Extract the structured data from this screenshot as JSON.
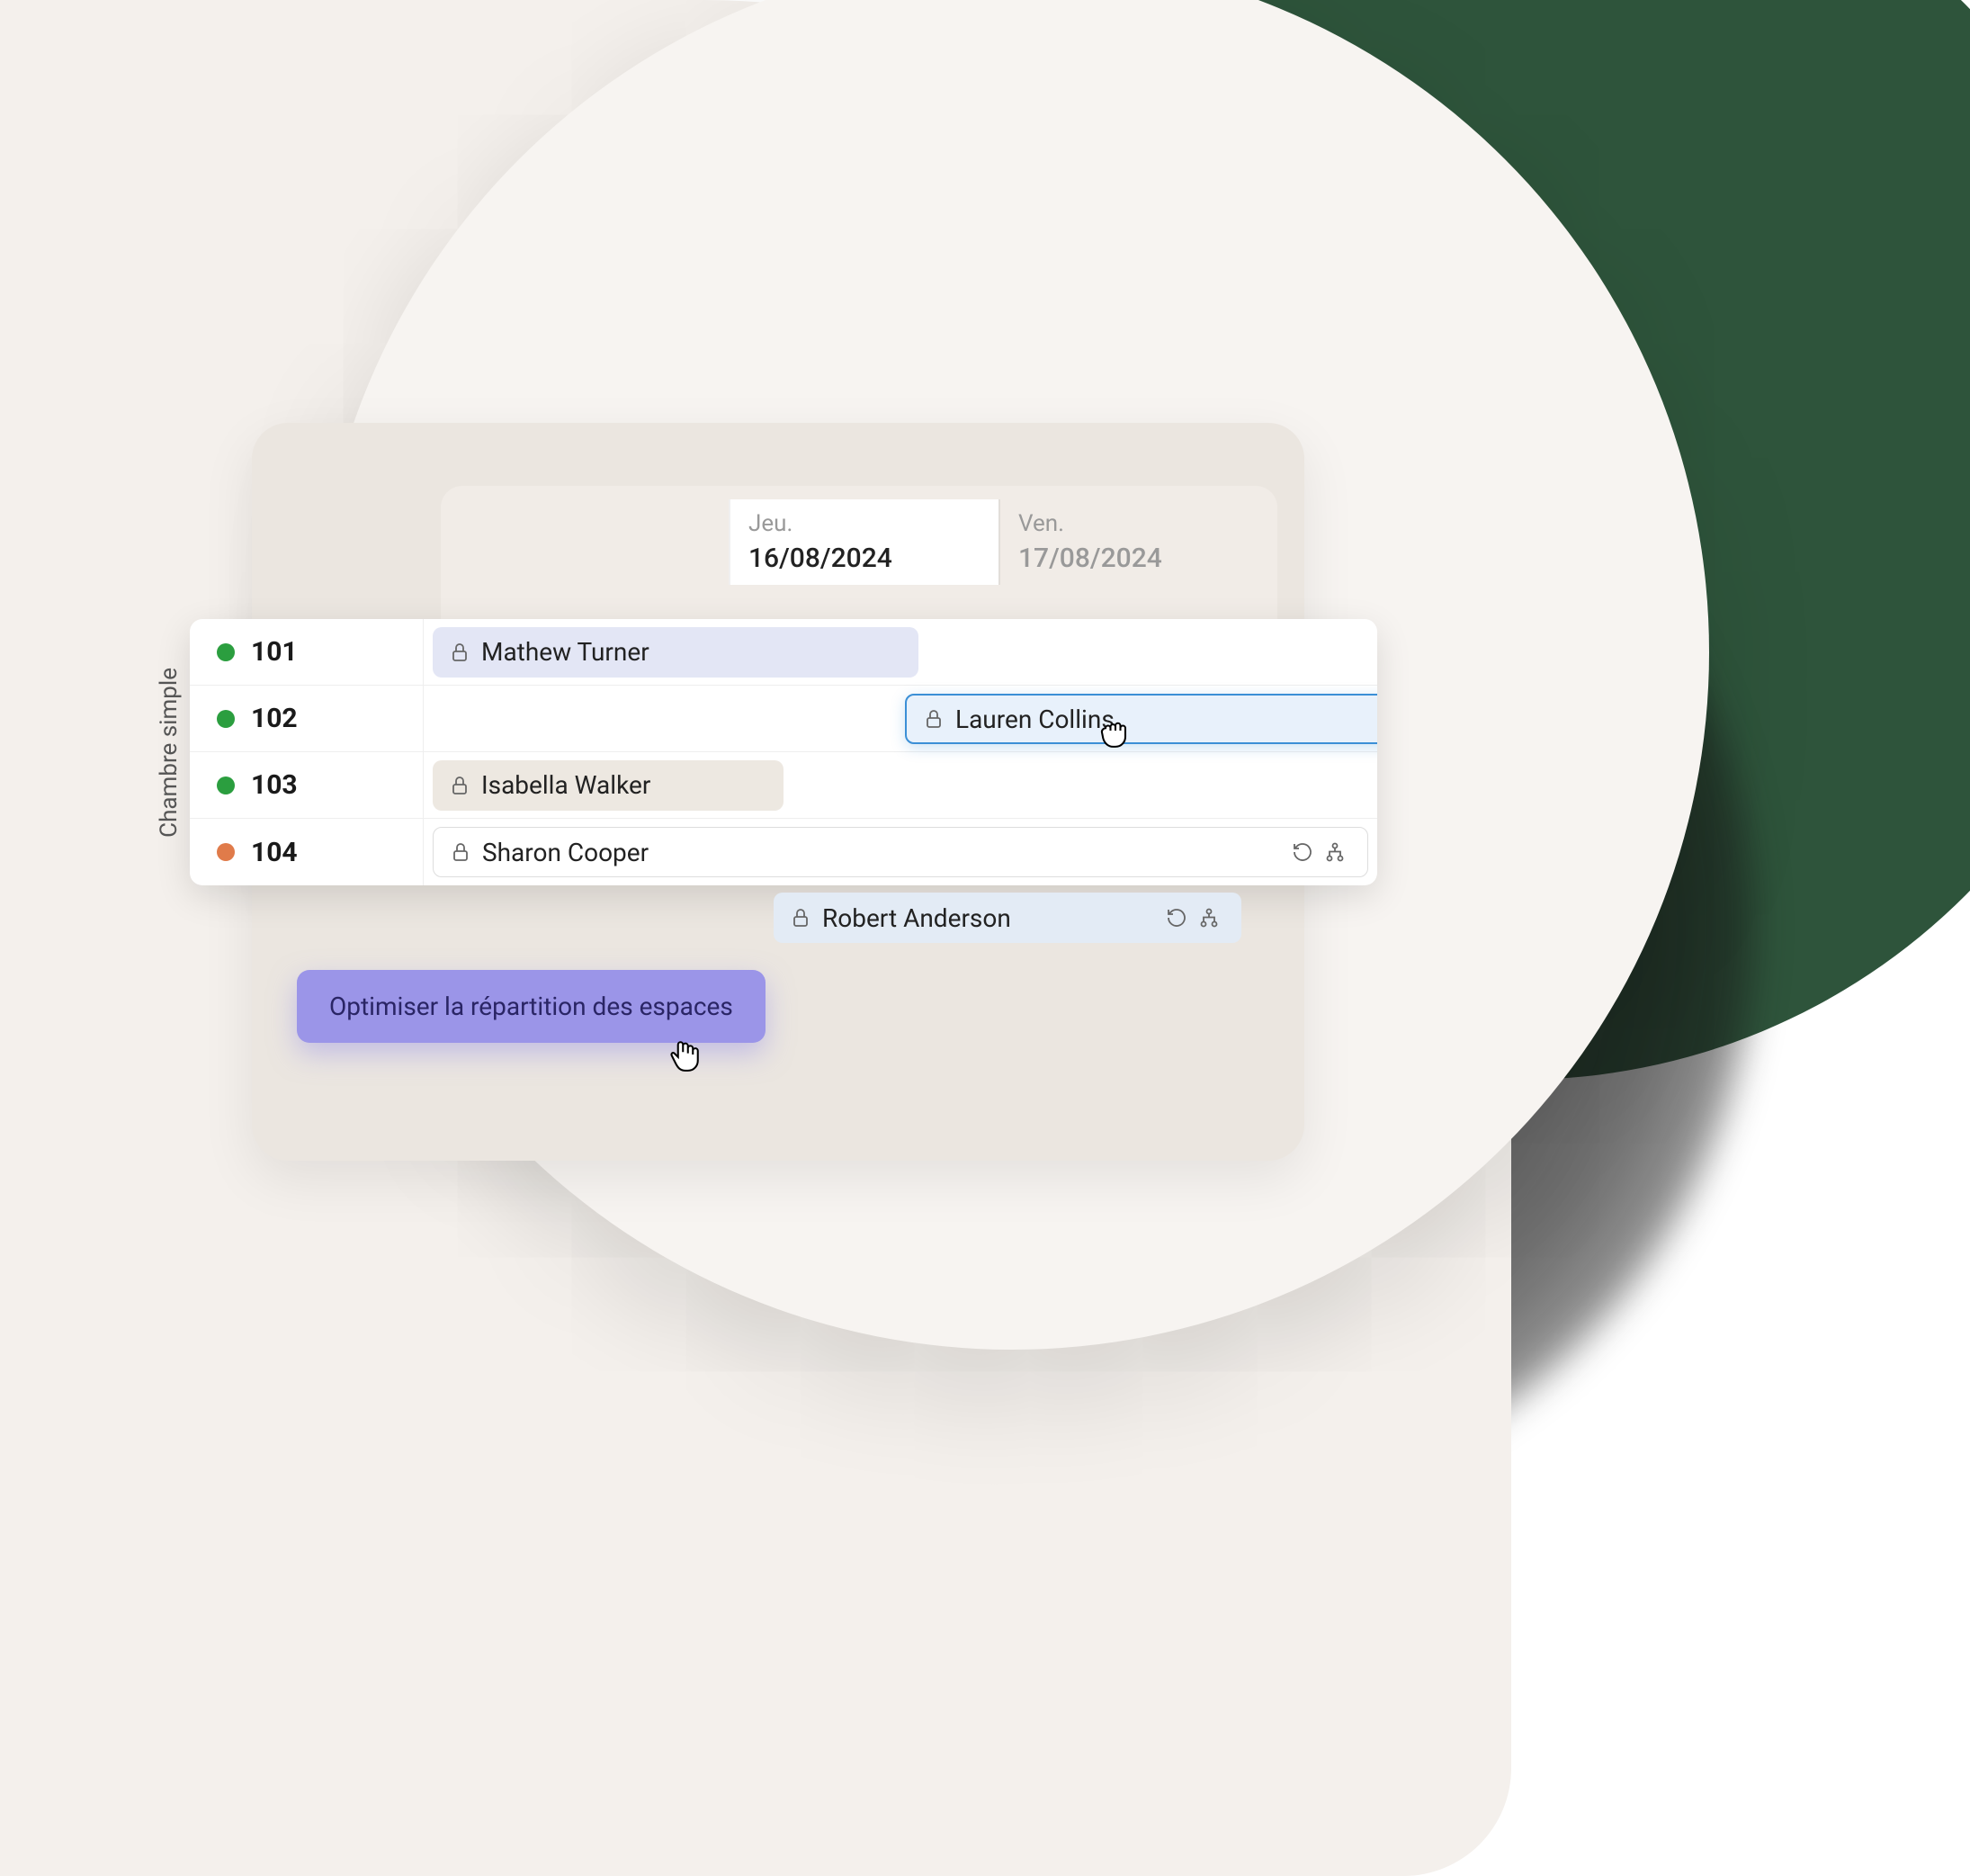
{
  "category_label": "Chambre simple",
  "dates": [
    {
      "day": "Jeu.",
      "date": "16/08/2024",
      "active": true
    },
    {
      "day": "Ven.",
      "date": "17/08/2024",
      "active": false
    }
  ],
  "rooms": [
    {
      "number": "101",
      "status": "green",
      "guest": "Mathew Turner",
      "style": "blue-light"
    },
    {
      "number": "102",
      "status": "green",
      "guest": "Lauren Collins",
      "style": "blue-outline"
    },
    {
      "number": "103",
      "status": "green",
      "guest": "Isabella Walker",
      "style": "beige"
    },
    {
      "number": "104",
      "status": "orange",
      "guest": "Sharon Cooper",
      "style": "white-outline"
    }
  ],
  "floating_booking": {
    "guest": "Robert Anderson",
    "style": "blue-soft"
  },
  "optimize_button": "Optimiser la répartition des espaces",
  "colors": {
    "green": "#2B9E3F",
    "orange": "#E07B4A",
    "accent_purple": "#9B95E8",
    "accent_blue": "#3B8FD6"
  }
}
